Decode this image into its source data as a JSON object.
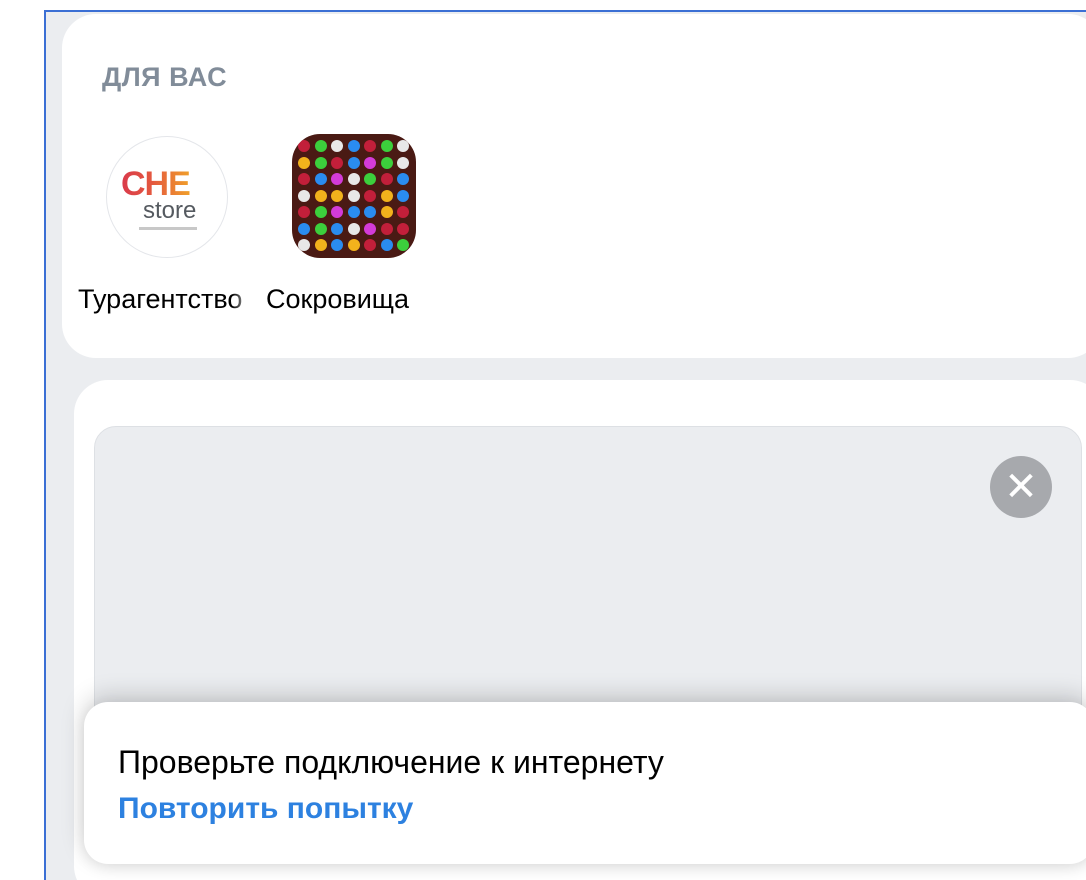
{
  "section": {
    "title": "ДЛЯ ВАС"
  },
  "apps": [
    {
      "label": "Турагентство",
      "icon_line1": "CHE",
      "icon_line2": "store"
    },
    {
      "label": "Сокровища"
    }
  ],
  "ad": {
    "close_icon": "✕"
  },
  "toast": {
    "message": "Проверьте подключение к интернету",
    "action": "Повторить попытку"
  },
  "colors": {
    "section_title": "#818c99",
    "link": "#2d81e0",
    "background": "#ebedf0",
    "frame_border": "#3b6fd4"
  }
}
